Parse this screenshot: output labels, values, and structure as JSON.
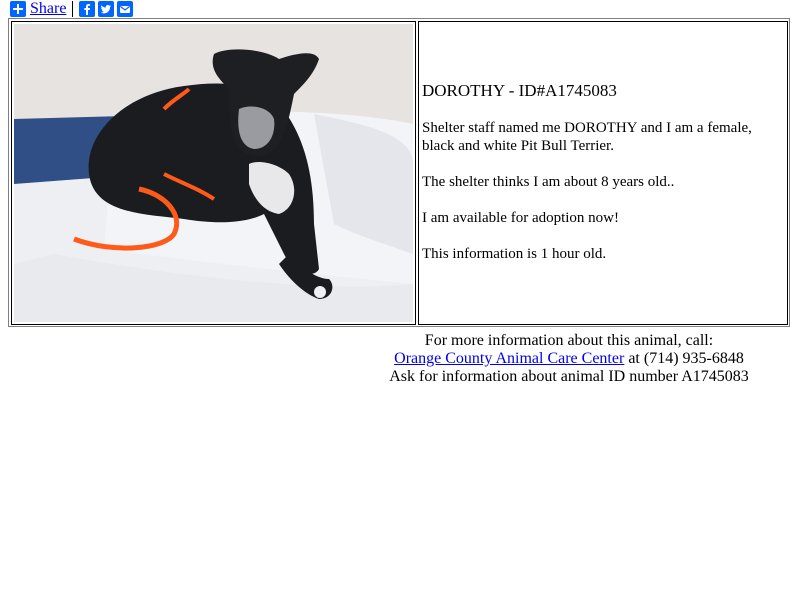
{
  "share": {
    "label": "Share",
    "icons": [
      "plus-icon",
      "facebook-icon",
      "twitter-icon",
      "email-icon"
    ],
    "accent_color": "#0166ff"
  },
  "animal": {
    "photo_alt": "black and white dog lying on a blanket",
    "title": "DOROTHY - ID#A1745083",
    "description": "Shelter staff named me DOROTHY and I am a female, black and white Pit Bull Terrier.",
    "age_text": "The shelter thinks I am about 8 years old..",
    "availability": "I am available for adoption now!",
    "freshness": "This information is 1 hour old."
  },
  "contact": {
    "intro": "For more information about this animal, call:",
    "shelter_name": "Orange County Animal Care Center",
    "phone_text": " at (714) 935-6848",
    "ask_text": "Ask for information about animal ID number A1745083"
  }
}
